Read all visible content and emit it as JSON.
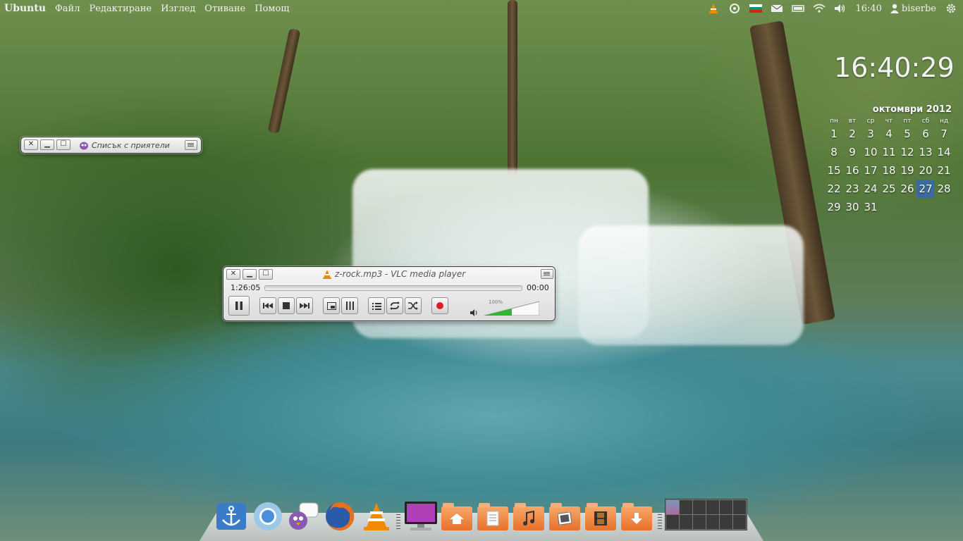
{
  "top_panel": {
    "app_title": "Ubuntu",
    "menus": [
      "Файл",
      "Редактиране",
      "Изглед",
      "Отиване",
      "Помощ"
    ],
    "clock": "16:40",
    "user": "biserbe"
  },
  "desktop_clock": "16:40:29",
  "calendar": {
    "title": "октомври 2012",
    "weekdays": [
      "пн",
      "вт",
      "ср",
      "чт",
      "пт",
      "сб",
      "нд"
    ],
    "weeks": [
      [
        "1",
        "2",
        "3",
        "4",
        "5",
        "6",
        "7"
      ],
      [
        "8",
        "9",
        "10",
        "11",
        "12",
        "13",
        "14"
      ],
      [
        "15",
        "16",
        "17",
        "18",
        "19",
        "20",
        "21"
      ],
      [
        "22",
        "23",
        "24",
        "25",
        "26",
        "27",
        "28"
      ],
      [
        "29",
        "30",
        "31",
        "",
        "",
        "",
        ""
      ]
    ],
    "today": "27",
    "today_color": "#3c6a9c"
  },
  "buddy_window": {
    "title": "Списък с приятели"
  },
  "vlc_window": {
    "title": "z-rock.mp3 - VLC media player",
    "elapsed": "1:26:05",
    "remaining": "00:00",
    "volume_label": "100%",
    "volume": 1.0
  },
  "dock": {
    "apps": [
      "anchor-app",
      "chromium-browser",
      "pidgin-chat",
      "firefox",
      "vlc-player",
      "computer",
      "home-folder",
      "documents-folder",
      "music-folder",
      "pictures-folder",
      "videos-folder",
      "downloads-folder"
    ],
    "workspaces": 12,
    "active_workspace": 1
  }
}
